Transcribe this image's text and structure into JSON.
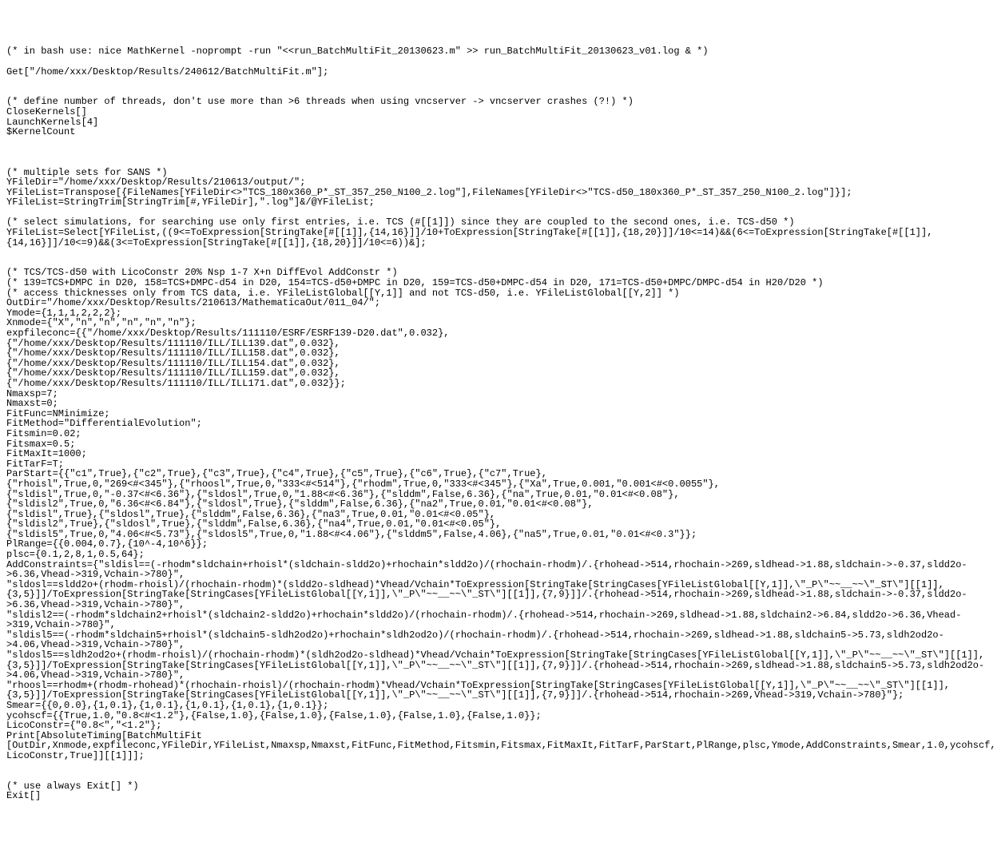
{
  "code": "(* in bash use: nice MathKernel -noprompt -run \"<<run_BatchMultiFit_20130623.m\" >> run_BatchMultiFit_20130623_v01.log & *)\n\nGet[\"/home/xxx/Desktop/Results/240612/BatchMultiFit.m\"];\n\n\n(* define number of threads, don't use more than >6 threads when using vncserver -> vncserver crashes (?!) *)\nCloseKernels[]\nLaunchKernels[4]\n$KernelCount\n\n\n\n(* multiple sets for SANS *)\nYFileDir=\"/home/xxx/Desktop/Results/210613/output/\";\nYFileList=Transpose[{FileNames[YFileDir<>\"TCS_180x360_P*_ST_357_250_N100_2.log\"],FileNames[YFileDir<>\"TCS-d50_180x360_P*_ST_357_250_N100_2.log\"]}];\nYFileList=StringTrim[StringTrim[#,YFileDir],\".log\"]&/@YFileList;\n\n(* select simulations, for searching use only first entries, i.e. TCS (#[[1]]) since they are coupled to the second ones, i.e. TCS-d50 *)\nYFileList=Select[YFileList,((9<=ToExpression[StringTake[#[[1]],{14,16}]]/10+ToExpression[StringTake[#[[1]],{18,20}]]/10<=14)&&(6<=ToExpression[StringTake[#[[1]],{14,16}]]/10<=9)&&(3<=ToExpression[StringTake[#[[1]],{18,20}]]/10<=6))&];\n\n\n(* TCS/TCS-d50 with LicoConstr 20% Nsp 1-7 X+n DiffEvol AddConstr *)\n(* 139=TCS+DMPC in D20, 158=TCS+DMPC-d54 in D20, 154=TCS-d50+DMPC in D20, 159=TCS-d50+DMPC-d54 in D20, 171=TCS-d50+DMPC/DMPC-d54 in H20/D20 *)\n(* access thicknesses only from TCS data, i.e. YFileListGlobal[[Y,1]] and not TCS-d50, i.e. YFileListGlobal[[Y,2]] *)\nOutDir=\"/home/xxx/Desktop/Results/210613/MathematicaOut/011_04/\";\nYmode={1,1,1,2,2,2};\nXnmode={\"X\",\"n\",\"n\",\"n\",\"n\",\"n\"};\nexpfileconc={{\"/home/xxx/Desktop/Results/111110/ESRF/ESRF139-D20.dat\",0.032},\n{\"/home/xxx/Desktop/Results/111110/ILL/ILL139.dat\",0.032},\n{\"/home/xxx/Desktop/Results/111110/ILL/ILL158.dat\",0.032},\n{\"/home/xxx/Desktop/Results/111110/ILL/ILL154.dat\",0.032},\n{\"/home/xxx/Desktop/Results/111110/ILL/ILL159.dat\",0.032},\n{\"/home/xxx/Desktop/Results/111110/ILL/ILL171.dat\",0.032}};\nNmaxsp=7;\nNmaxst=0;\nFitFunc=NMinimize;\nFitMethod=\"DifferentialEvolution\";\nFitsmin=0.02;\nFitsmax=0.5;\nFitMaxIt=1000;\nFitTarF=T;\nParStart={{\"c1\",True},{\"c2\",True},{\"c3\",True},{\"c4\",True},{\"c5\",True},{\"c6\",True},{\"c7\",True},\n{\"rhoisl\",True,0,\"269<#<345\"},{\"rhoosl\",True,0,\"333<#<514\"},{\"rhodm\",True,0,\"333<#<345\"},{\"Xa\",True,0.001,\"0.001<#<0.0055\"},\n{\"sldisl\",True,0,\"-0.37<#<6.36\"},{\"sldosl\",True,0,\"1.88<#<6.36\"},{\"slddm\",False,6.36},{\"na\",True,0.01,\"0.01<#<0.08\"},\n{\"sldisl2\",True,0,\"6.36<#<6.84\"},{\"sldosl\",True},{\"slddm\",False,6.36},{\"na2\",True,0.01,\"0.01<#<0.08\"},\n{\"sldisl\",True},{\"sldosl\",True},{\"slddm\",False,6.36},{\"na3\",True,0.01,\"0.01<#<0.05\"},\n{\"sldisl2\",True},{\"sldosl\",True},{\"slddm\",False,6.36},{\"na4\",True,0.01,\"0.01<#<0.05\"},\n{\"sldisl5\",True,0,\"4.06<#<5.73\"},{\"sldosl5\",True,0,\"1.88<#<4.06\"},{\"slddm5\",False,4.06},{\"na5\",True,0.01,\"0.01<#<0.3\"}};\nPlRange={{0.004,0.7},{10^-4,10^6}};\nplsc={0.1,2,8,1,0.5,64};\nAddConstraints={\"sldisl==(-rhodm*sldchain+rhoisl*(sldchain-sldd2o)+rhochain*sldd2o)/(rhochain-rhodm)/.{rhohead->514,rhochain->269,sldhead->1.88,sldchain->-0.37,sldd2o->6.36,Vhead->319,Vchain->780}\",\n\"sldosl==sldd2o+(rhodm-rhoisl)/(rhochain-rhodm)*(sldd2o-sldhead)*Vhead/Vchain*ToExpression[StringTake[StringCases[YFileListGlobal[[Y,1]],\\\"_P\\\"~~__~~\\\"_ST\\\"][[1]],{3,5}]]/ToExpression[StringTake[StringCases[YFileListGlobal[[Y,1]],\\\"_P\\\"~~__~~\\\"_ST\\\"][[1]],{7,9}]]/.{rhohead->514,rhochain->269,sldhead->1.88,sldchain->-0.37,sldd2o->6.36,Vhead->319,Vchain->780}\",\n\"sldisl2==(-rhodm*sldchain2+rhoisl*(sldchain2-sldd2o)+rhochain*sldd2o)/(rhochain-rhodm)/.{rhohead->514,rhochain->269,sldhead->1.88,sldchain2->6.84,sldd2o->6.36,Vhead->319,Vchain->780}\",\n\"sldisl5==(-rhodm*sldchain5+rhoisl*(sldchain5-sldh2od2o)+rhochain*sldh2od2o)/(rhochain-rhodm)/.{rhohead->514,rhochain->269,sldhead->1.88,sldchain5->5.73,sldh2od2o->4.06,Vhead->319,Vchain->780}\",\n\"sldosl5==sldh2od2o+(rhodm-rhoisl)/(rhochain-rhodm)*(sldh2od2o-sldhead)*Vhead/Vchain*ToExpression[StringTake[StringCases[YFileListGlobal[[Y,1]],\\\"_P\\\"~~__~~\\\"_ST\\\"][[1]],{3,5}]]/ToExpression[StringTake[StringCases[YFileListGlobal[[Y,1]],\\\"_P\\\"~~__~~\\\"_ST\\\"][[1]],{7,9}]]/.{rhohead->514,rhochain->269,sldhead->1.88,sldchain5->5.73,sldh2od2o->4.06,Vhead->319,Vchain->780}\",\n\"rhoosl==rhodm+(rhodm-rhohead)*(rhochain-rhoisl)/(rhochain-rhodm)*Vhead/Vchain*ToExpression[StringTake[StringCases[YFileListGlobal[[Y,1]],\\\"_P\\\"~~__~~\\\"_ST\\\"][[1]],{3,5}]]/ToExpression[StringTake[StringCases[YFileListGlobal[[Y,1]],\\\"_P\\\"~~__~~\\\"_ST\\\"][[1]],{7,9}]]/.{rhohead->514,rhochain->269,Vhead->319,Vchain->780}\"};\nSmear={{0,0.0},{1,0.1},{1,0.1},{1,0.1},{1,0.1},{1,0.1}};\nycohscf={{True,1.0,\"0.8<#<1.2\"},{False,1.0},{False,1.0},{False,1.0},{False,1.0},{False,1.0}};\nLicoConstr={\"0.8<\",\"<1.2\"};\nPrint[AbsoluteTiming[BatchMultiFit\n[OutDir,Xnmode,expfileconc,YFileDir,YFileList,Nmaxsp,Nmaxst,FitFunc,FitMethod,Fitsmin,Fitsmax,FitMaxIt,FitTarF,ParStart,PlRange,plsc,Ymode,AddConstraints,Smear,1.0,ycohscf,LicoConstr,True]][[1]]];\n\n\n(* use always Exit[] *)\nExit[]"
}
